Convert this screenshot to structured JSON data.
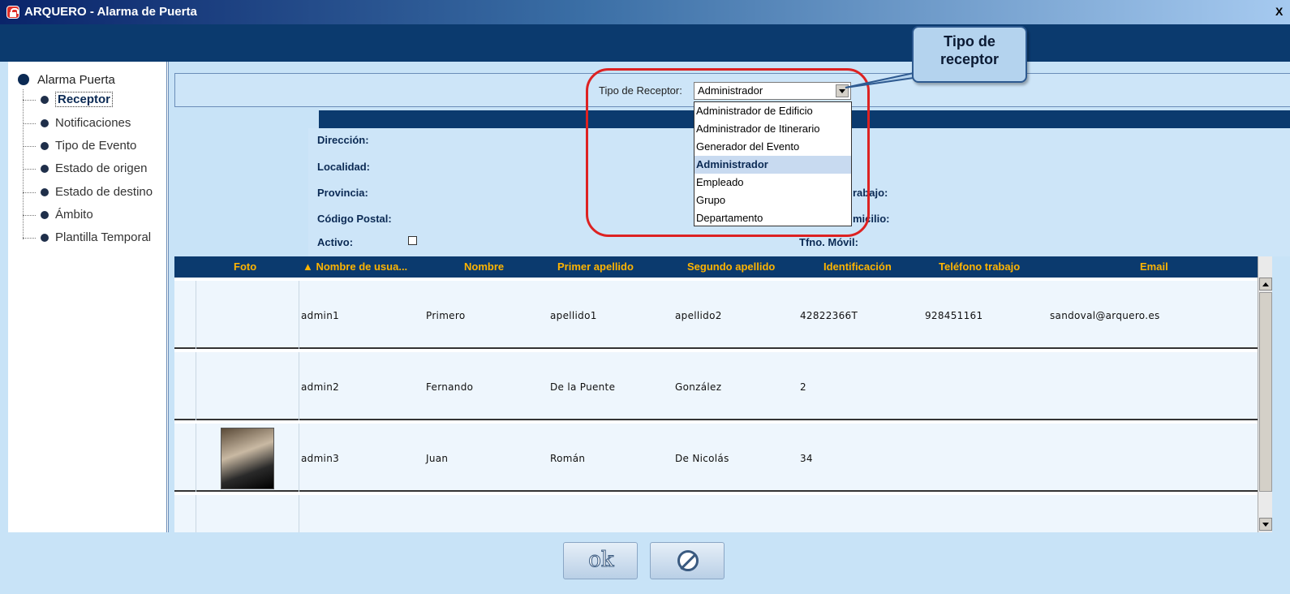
{
  "window": {
    "title": "ARQUERO - Alarma de Puerta",
    "close_label": "X"
  },
  "sidebar": {
    "root": "Alarma Puerta",
    "items": [
      {
        "label": "Receptor"
      },
      {
        "label": "Notificaciones"
      },
      {
        "label": "Tipo de Evento"
      },
      {
        "label": "Estado de origen"
      },
      {
        "label": "Estado de destino"
      },
      {
        "label": "Ámbito"
      },
      {
        "label": "Plantilla Temporal"
      }
    ]
  },
  "receptor": {
    "label": "Tipo de Receptor:",
    "selected": "Administrador",
    "options": [
      "Administrador de Edificio",
      "Administrador de Itinerario",
      "Generador del Evento",
      "Administrador",
      "Empleado",
      "Grupo",
      "Departamento"
    ]
  },
  "callout": {
    "line1": "Tipo de",
    "line2": "receptor"
  },
  "form": {
    "direccion": "Dirección:",
    "localidad": "Localidad:",
    "provincia": "Provincia:",
    "codigo_postal": "Código Postal:",
    "activo": "Activo:",
    "tel_trabajo_partial": "rabajo:",
    "domicilio_partial": "micilio:",
    "tel_movil": "Tfno. Móvil:"
  },
  "table": {
    "columns": [
      "Foto",
      "▲ Nombre de usua...",
      "Nombre",
      "Primer apellido",
      "Segundo apellido",
      "Identificación",
      "Teléfono trabajo",
      "Email"
    ],
    "rows": [
      {
        "user": "admin1",
        "nombre": "Primero",
        "ap1": "apellido1",
        "ap2": "apellido2",
        "id": "42822366T",
        "tel": "928451161",
        "email": "sandoval@arquero.es"
      },
      {
        "user": "admin2",
        "nombre": "Fernando",
        "ap1": "De la Puente",
        "ap2": "González",
        "id": "2",
        "tel": "",
        "email": ""
      },
      {
        "user": "admin3",
        "nombre": "Juan",
        "ap1": "Román",
        "ap2": "De Nicolás",
        "id": "34",
        "tel": "",
        "email": ""
      }
    ]
  },
  "buttons": {
    "ok": "ok"
  },
  "colors": {
    "header": "#0b3a6e",
    "column_header_text": "#ffb400",
    "highlight": "#dd2222"
  }
}
